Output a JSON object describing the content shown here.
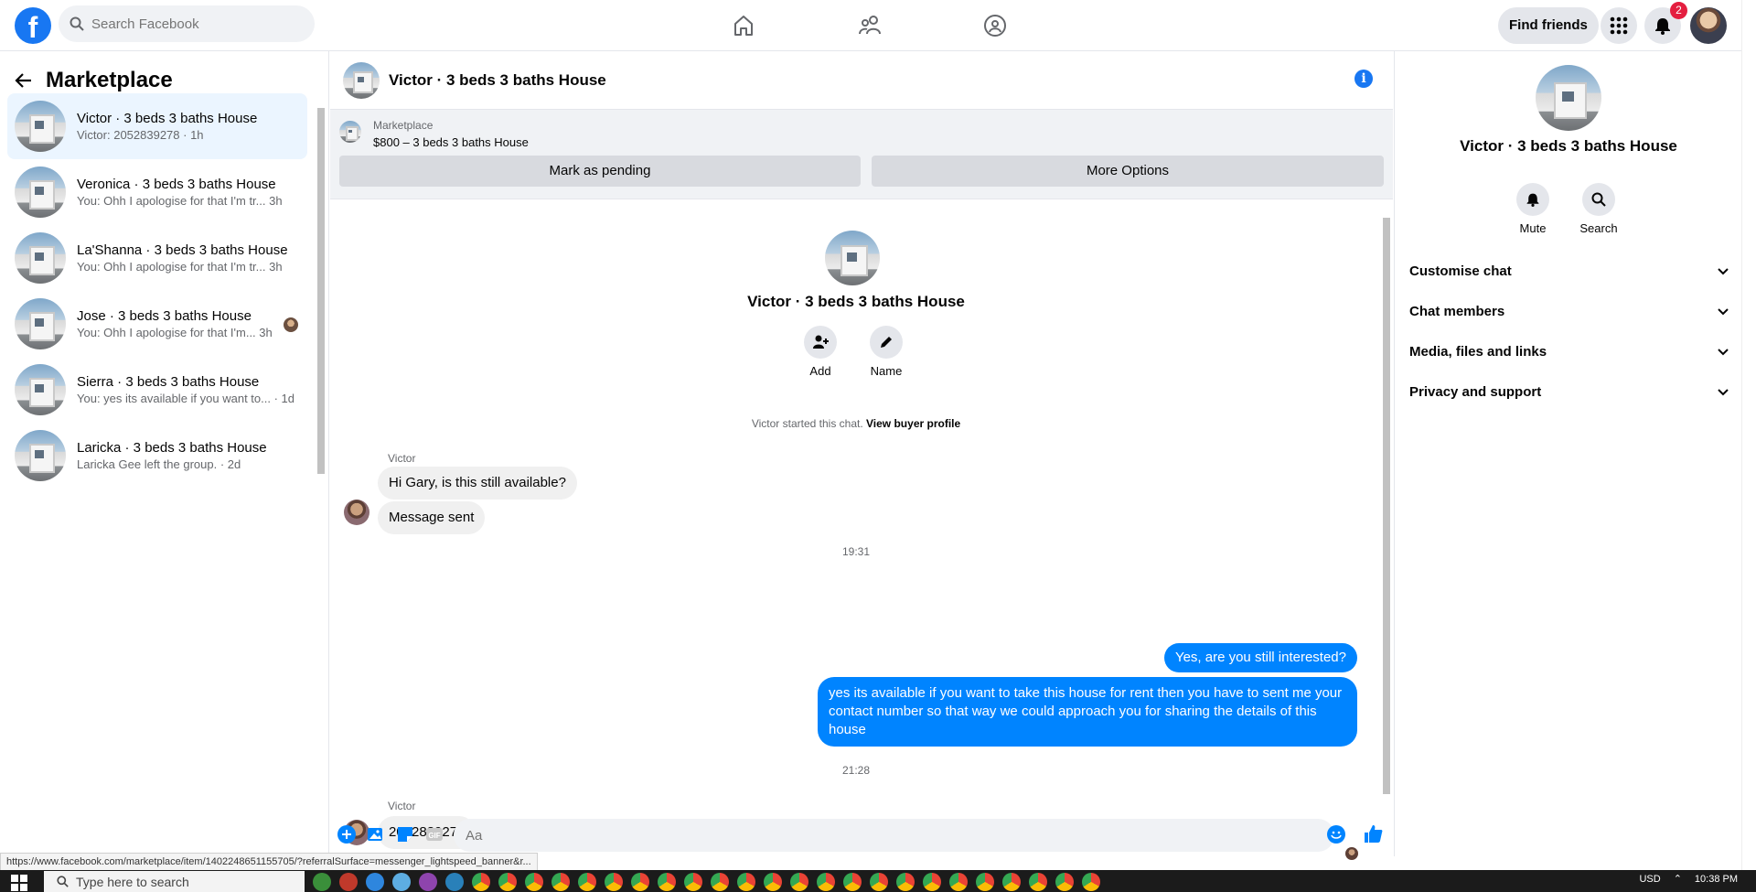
{
  "topbar": {
    "logo": "f",
    "search_placeholder": "Search Facebook",
    "find_friends": "Find friends",
    "notification_count": "2"
  },
  "left": {
    "title": "Marketplace",
    "conversations": [
      {
        "name": "Victor · 3 beds 3 baths House",
        "snippet": "Victor: 2052839278 · 1h"
      },
      {
        "name": "Veronica · 3 beds 3 baths House",
        "snippet": "You: Ohh I apologise for that I'm tr...  3h"
      },
      {
        "name": "La'Shanna · 3 beds 3 baths House",
        "snippet": "You: Ohh I apologise for that I'm tr...  3h"
      },
      {
        "name": "Jose · 3 beds 3 baths House",
        "snippet": "You: Ohh I apologise for that I'm...  3h"
      },
      {
        "name": "Sierra · 3 beds 3 baths House",
        "snippet": "You: yes its available if you want to... · 1d"
      },
      {
        "name": "Laricka · 3 beds 3 baths House",
        "snippet": "Laricka Gee left the group. · 2d"
      }
    ]
  },
  "chat": {
    "title": "Victor · 3 beds 3 baths House",
    "marketplace_label": "Marketplace",
    "listing": "$800 – 3 beds 3 baths House",
    "mark_pending": "Mark as pending",
    "more_options": "More Options",
    "intro_name": "Victor · 3 beds 3 baths House",
    "add_label": "Add",
    "name_label": "Name",
    "started_text": "Victor started this chat.",
    "buyer_profile": "View buyer profile",
    "sender": "Victor",
    "msg1": "Hi Gary, is this still available?",
    "msg2": "Message sent",
    "time1": "19:31",
    "out1": "Yes, are you still interested?",
    "out2": "yes its available if you want to take this house for rent then you have to sent me your contact number so that way we could approach you for sharing the details of this house",
    "time2": "21:28",
    "sender2": "Victor",
    "msg3": "2052839278",
    "composer_placeholder": "Aa"
  },
  "right": {
    "name": "Victor · 3 beds 3 baths House",
    "mute": "Mute",
    "search": "Search",
    "sections": [
      "Customise chat",
      "Chat members",
      "Media, files and links",
      "Privacy and support"
    ]
  },
  "status_url": "https://www.facebook.com/marketplace/item/1402248651155705/?referralSurface=messenger_lightspeed_banner&r...",
  "taskbar": {
    "search_placeholder": "Type here to search",
    "currency": "USD",
    "clock": "10:38 PM"
  },
  "colors": {
    "brand": "#1877f2",
    "outgoing_bubble": "#0084ff",
    "badge": "#e41e3f"
  }
}
